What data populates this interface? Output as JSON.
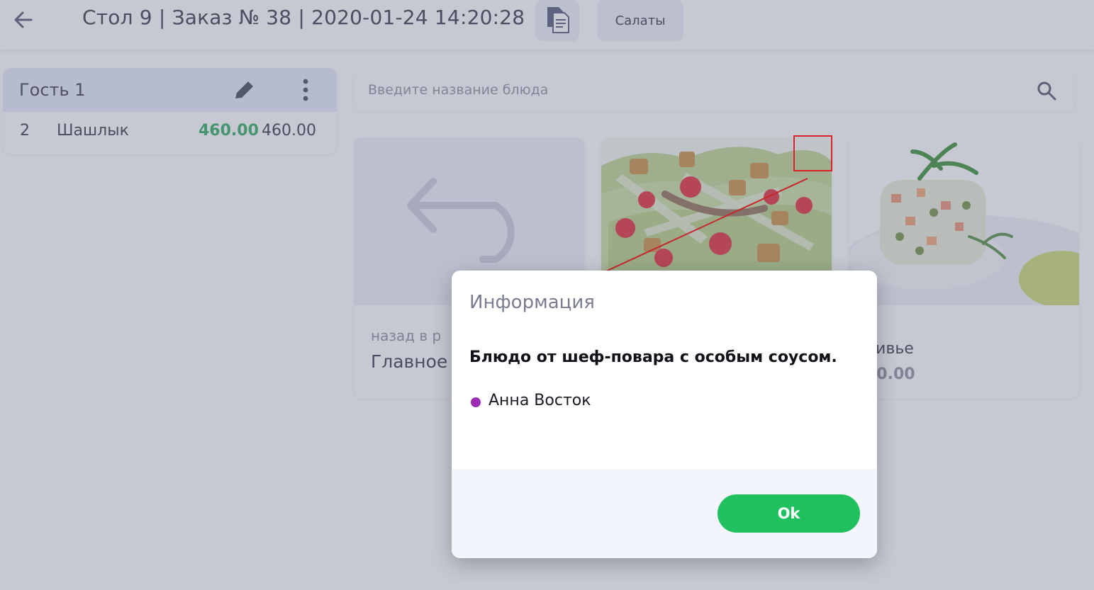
{
  "header": {
    "title": "Стол 9 | Заказ № 38 | 2020-01-24 14:20:28",
    "category_chip": "Салаты"
  },
  "guest": {
    "name": "Гость 1",
    "items": [
      {
        "qty": "2",
        "name": "Шашлык",
        "price": "460.00",
        "total": "460.00"
      }
    ]
  },
  "search": {
    "placeholder": "Введите название блюда"
  },
  "tiles": [
    {
      "subtitle": "назад в р",
      "name": "Главное"
    },
    {
      "subtitle": "",
      "name": ""
    },
    {
      "name": "ливье",
      "price": "20.00"
    }
  ],
  "dialog": {
    "title": "Информация",
    "message": "Блюдо от шеф-повара с особым соусом.",
    "author": "Анна Восток",
    "author_dot_color": "#9b2bb4",
    "ok_label": "Ok"
  },
  "colors": {
    "accent_green": "#21c05f",
    "price_green": "#22a855",
    "marker_red": "#d8232a"
  }
}
